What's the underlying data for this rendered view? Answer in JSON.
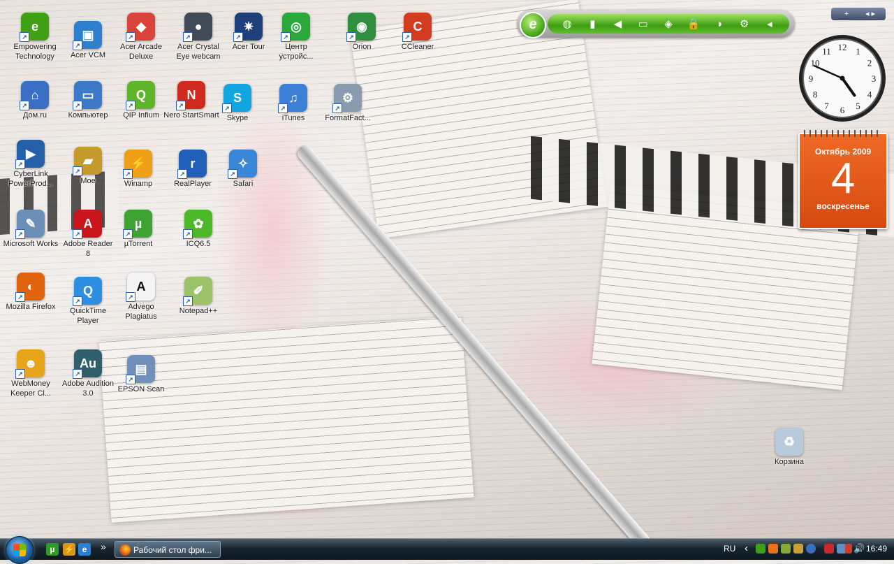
{
  "desktop_icons": [
    {
      "label": "Empowering Technology",
      "icon": "empowering-technology-icon",
      "color": "#3fa016",
      "glyph": "e"
    },
    {
      "label": "Acer VCM",
      "icon": "acer-vcm-icon",
      "color": "#2f7fcf",
      "glyph": "▣"
    },
    {
      "label": "Acer Arcade Deluxe",
      "icon": "acer-arcade-icon",
      "color": "#d9433a",
      "glyph": "◆"
    },
    {
      "label": "Acer Crystal Eye webcam",
      "icon": "webcam-icon",
      "color": "#404a58",
      "glyph": "●"
    },
    {
      "label": "Acer Tour",
      "icon": "acer-tour-icon",
      "color": "#1d3f7a",
      "glyph": "✷"
    },
    {
      "label": "Центр устройс...",
      "icon": "device-center-icon",
      "color": "#2aa83c",
      "glyph": "◎"
    },
    {
      "label": "Orion",
      "icon": "orion-icon",
      "color": "#2f8f3f",
      "glyph": "◉"
    },
    {
      "label": "CCleaner",
      "icon": "ccleaner-icon",
      "color": "#d23c21",
      "glyph": "C"
    },
    {
      "label": "Дом.ru",
      "icon": "network-computer-icon",
      "color": "#3b6fc4",
      "glyph": "⌂"
    },
    {
      "label": "Компьютер",
      "icon": "computer-icon",
      "color": "#3d79c9",
      "glyph": "▭"
    },
    {
      "label": "QIP Infium",
      "icon": "qip-infium-icon",
      "color": "#5fb52a",
      "glyph": "Q"
    },
    {
      "label": "Nero StartSmart",
      "icon": "nero-icon",
      "color": "#d02a20",
      "glyph": "N"
    },
    {
      "label": "Skype",
      "icon": "skype-icon",
      "color": "#12a5e0",
      "glyph": "S"
    },
    {
      "label": "iTunes",
      "icon": "itunes-icon",
      "color": "#3c7fd6",
      "glyph": "♫"
    },
    {
      "label": "FormatFact...",
      "icon": "format-factory-icon",
      "color": "#8a9bb0",
      "glyph": "⚙"
    },
    {
      "label": "CyberLink PowerProd...",
      "icon": "cyberlink-icon",
      "color": "#2460a8",
      "glyph": "▶"
    },
    {
      "label": "Мое",
      "icon": "folder-icon",
      "color": "#c79a2c",
      "glyph": "▰"
    },
    {
      "label": "Winamp",
      "icon": "winamp-icon",
      "color": "#f0a018",
      "glyph": "⚡"
    },
    {
      "label": "RealPlayer",
      "icon": "realplayer-icon",
      "color": "#1f5fb8",
      "glyph": "r"
    },
    {
      "label": "Safari",
      "icon": "safari-icon",
      "color": "#3a87d8",
      "glyph": "✧"
    },
    {
      "label": "Microsoft Works",
      "icon": "microsoft-works-icon",
      "color": "#6c8fb8",
      "glyph": "✎"
    },
    {
      "label": "Adobe Reader 8",
      "icon": "adobe-reader-icon",
      "color": "#c8141a",
      "glyph": "A"
    },
    {
      "label": "µTorrent",
      "icon": "utorrent-icon",
      "color": "#3da434",
      "glyph": "µ"
    },
    {
      "label": "ICQ6.5",
      "icon": "icq-icon",
      "color": "#4cb82a",
      "glyph": "✿"
    },
    {
      "label": "Mozilla Firefox",
      "icon": "firefox-icon",
      "color": "#e0640e",
      "glyph": "◐"
    },
    {
      "label": "QuickTime Player",
      "icon": "quicktime-icon",
      "color": "#2d8fe0",
      "glyph": "Q"
    },
    {
      "label": "Advego Plagiatus",
      "icon": "advego-plagiatus-icon",
      "color": "#f4f4f4",
      "glyph": "A"
    },
    {
      "label": "Notepad++",
      "icon": "notepad-plus-icon",
      "color": "#9bc46a",
      "glyph": "✐"
    },
    {
      "label": "WebMoney Keeper Cl...",
      "icon": "webmoney-icon",
      "color": "#e8a51c",
      "glyph": "☻"
    },
    {
      "label": "Adobe Audition 3.0",
      "icon": "adobe-audition-icon",
      "color": "#2f5f6a",
      "glyph": "Au"
    },
    {
      "label": "EPSON Scan",
      "icon": "epson-scan-icon",
      "color": "#6f90b8",
      "glyph": "▤"
    },
    {
      "label": "Корзина",
      "icon": "recycle-bin-icon",
      "color": "#b8cbdc",
      "glyph": "♻"
    }
  ],
  "gadgets": {
    "toolbar_logo": "e",
    "toolbar_icons": [
      "globe-icon",
      "battery-icon",
      "speaker-icon",
      "projector-icon",
      "light-icon",
      "lock-icon",
      "power-icon",
      "gear-icon",
      "collapse-icon"
    ],
    "sidebar_add": "+",
    "sidebar_nav": "◂ ▸",
    "clock": {
      "hour": 4,
      "minute": 49
    },
    "calendar": {
      "month_year": "Октябрь 2009",
      "day": "4",
      "weekday": "воскресенье"
    }
  },
  "taskbar": {
    "start": "start-button",
    "quick_launch_more": "»",
    "task_label": "Рабочий стол фри...",
    "lang": "RU",
    "tray_arrow": "‹",
    "time": "16:49"
  },
  "colors": {
    "accent_green": "#3fa016",
    "calendar_orange": "#e35a1a",
    "taskbar_dark": "#18252f"
  }
}
